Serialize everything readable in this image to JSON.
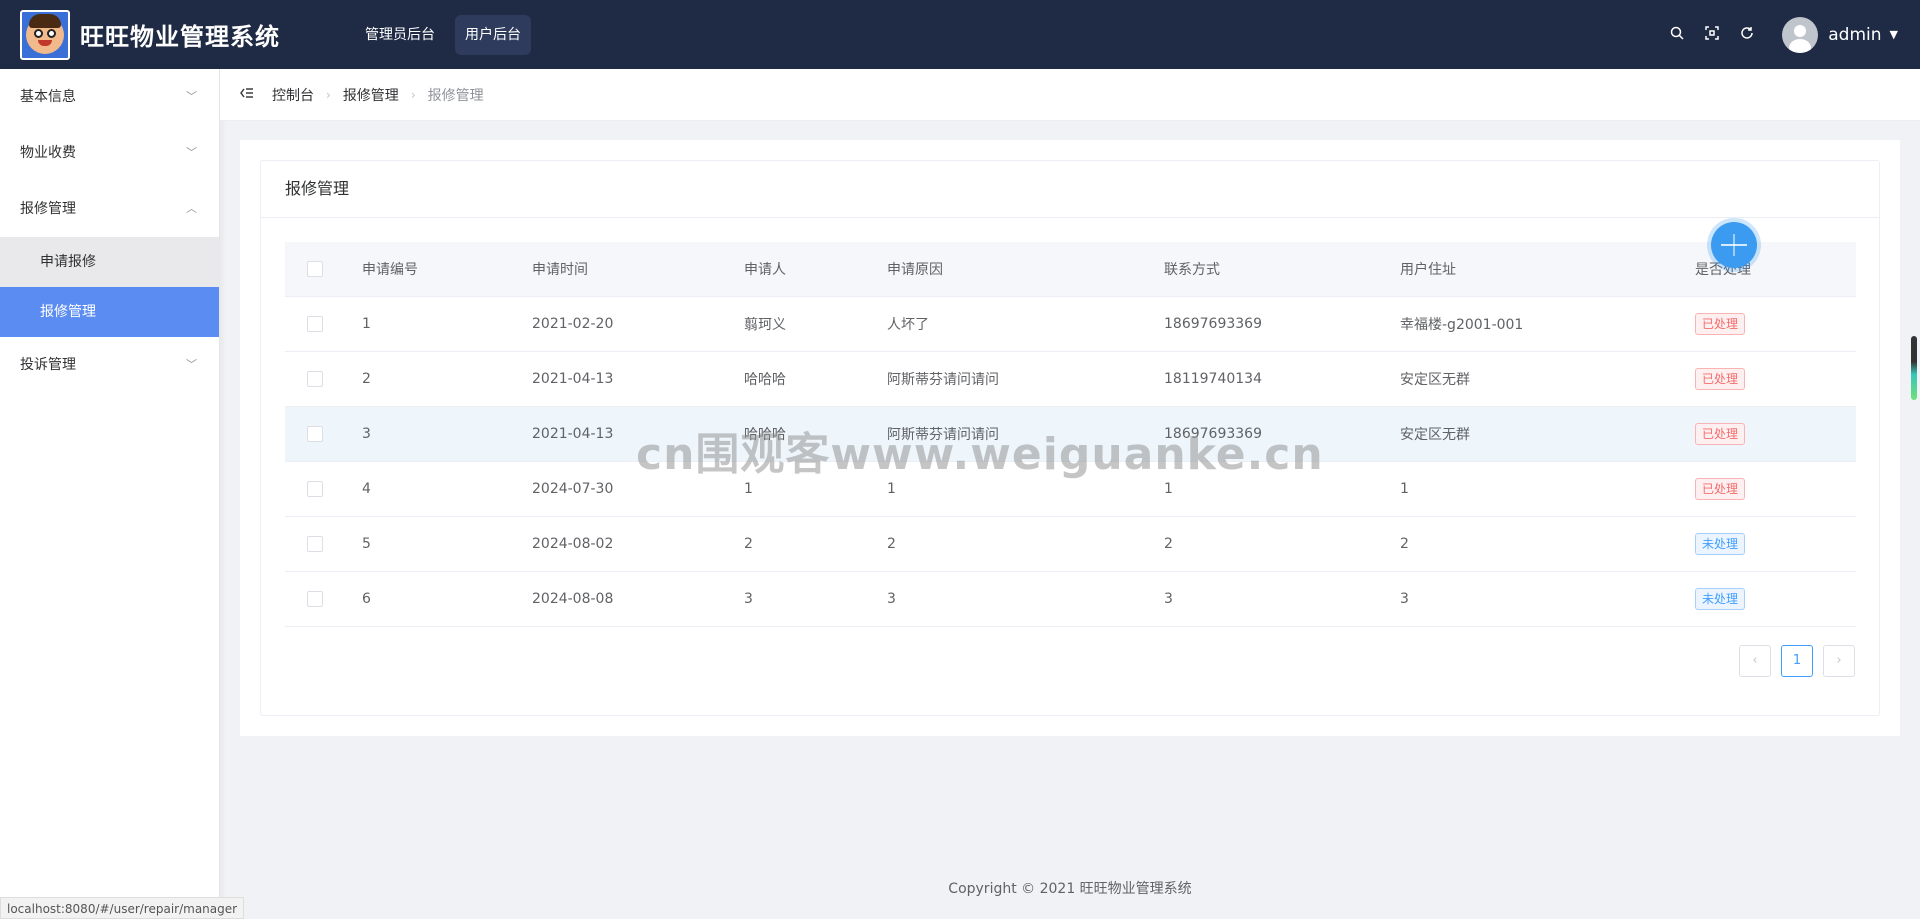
{
  "header": {
    "title": "旺旺物业管理系统",
    "nav": [
      {
        "label": "管理员后台"
      },
      {
        "label": "用户后台"
      }
    ],
    "icons": [
      "search-icon",
      "fullscreen-icon",
      "refresh-icon"
    ],
    "username": "admin"
  },
  "sidebar": {
    "items": [
      {
        "label": "基本信息"
      },
      {
        "label": "物业收费"
      },
      {
        "label": "报修管理"
      },
      {
        "label": "投诉管理"
      }
    ],
    "sub_items": [
      {
        "label": "申请报修"
      },
      {
        "label": "报修管理"
      }
    ]
  },
  "breadcrumb": [
    "控制台",
    "报修管理",
    "报修管理"
  ],
  "card": {
    "title": "报修管理"
  },
  "table": {
    "columns": [
      "申请编号",
      "申请时间",
      "申请人",
      "申请原因",
      "联系方式",
      "用户住址",
      "是否处理"
    ],
    "rows": [
      {
        "id": "1",
        "time": "2021-02-20",
        "applicant": "翦珂义",
        "reason": "人坏了",
        "contact": "18697693369",
        "address": "幸福楼-g2001-001",
        "status": "已处理"
      },
      {
        "id": "2",
        "time": "2021-04-13",
        "applicant": "哈哈哈",
        "reason": "阿斯蒂芬请问请问",
        "contact": "18119740134",
        "address": "安定区无群",
        "status": "已处理"
      },
      {
        "id": "3",
        "time": "2021-04-13",
        "applicant": "哈哈哈",
        "reason": "阿斯蒂芬请问请问",
        "contact": "18697693369",
        "address": "安定区无群",
        "status": "已处理"
      },
      {
        "id": "4",
        "time": "2024-07-30",
        "applicant": "1",
        "reason": "1",
        "contact": "1",
        "address": "1",
        "status": "已处理"
      },
      {
        "id": "5",
        "time": "2024-08-02",
        "applicant": "2",
        "reason": "2",
        "contact": "2",
        "address": "2",
        "status": "未处理"
      },
      {
        "id": "6",
        "time": "2024-08-08",
        "applicant": "3",
        "reason": "3",
        "contact": "3",
        "address": "3",
        "status": "未处理"
      }
    ]
  },
  "pagination": {
    "current": "1",
    "prev": "‹",
    "next": "›"
  },
  "footer": "Copyright © 2021 旺旺物业管理系统",
  "status_url": "localhost:8080/#/user/repair/manager",
  "watermark": "cn围观客www.weiguanke.cn",
  "colors": {
    "header_bg": "#1f2a44",
    "active_menu": "#5b8cf2",
    "done_tag": "#f56c6c",
    "undone_tag": "#409eff"
  }
}
